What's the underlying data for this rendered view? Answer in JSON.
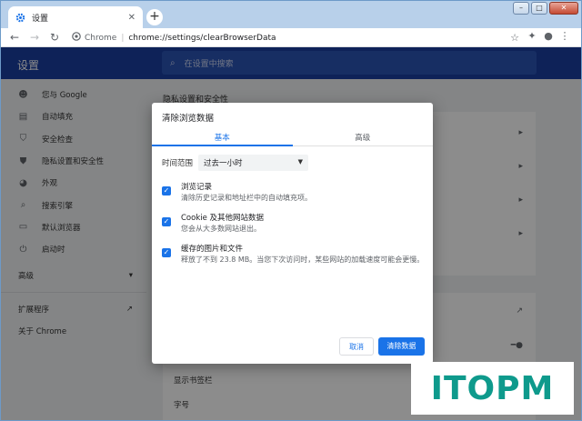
{
  "browser": {
    "tab_title": "设置",
    "address_site": "Chrome",
    "address_url": "chrome://settings/clearBrowserData"
  },
  "header": {
    "title": "设置",
    "search_placeholder": "在设置中搜索"
  },
  "sidebar": {
    "items": [
      {
        "label": "您与 Google",
        "icon": "person-icon"
      },
      {
        "label": "自动填充",
        "icon": "clipboard-icon"
      },
      {
        "label": "安全检查",
        "icon": "shield-icon"
      },
      {
        "label": "隐私设置和安全性",
        "icon": "shield-lock-icon"
      },
      {
        "label": "外观",
        "icon": "palette-icon"
      },
      {
        "label": "搜索引擎",
        "icon": "search-icon"
      },
      {
        "label": "默认浏览器",
        "icon": "browser-icon"
      },
      {
        "label": "启动时",
        "icon": "power-icon"
      }
    ],
    "advanced": "高级",
    "extensions": "扩展程序",
    "about": "关于 Chrome"
  },
  "content": {
    "section_title": "隐私设置和安全性",
    "bottom_items": [
      "显示书签栏",
      "字号"
    ]
  },
  "dialog": {
    "title": "清除浏览数据",
    "tab_basic": "基本",
    "tab_advanced": "高级",
    "time_range_label": "时间范围",
    "time_range_value": "过去一小时",
    "options": [
      {
        "title": "浏览记录",
        "desc": "清除历史记录和地址栏中的自动填充项。",
        "checked": true
      },
      {
        "title": "Cookie 及其他网站数据",
        "desc": "您会从大多数网站退出。",
        "checked": true
      },
      {
        "title": "缓存的图片和文件",
        "desc": "释放了不到 23.8 MB。当您下次访问时，某些网站的加载速度可能会更慢。",
        "checked": true
      }
    ],
    "cancel": "取消",
    "confirm": "清除数据"
  },
  "watermark": "ITOPM",
  "colors": {
    "accent": "#1a73e8",
    "header": "#1a3fa0",
    "watermark": "#0e9a8c"
  }
}
